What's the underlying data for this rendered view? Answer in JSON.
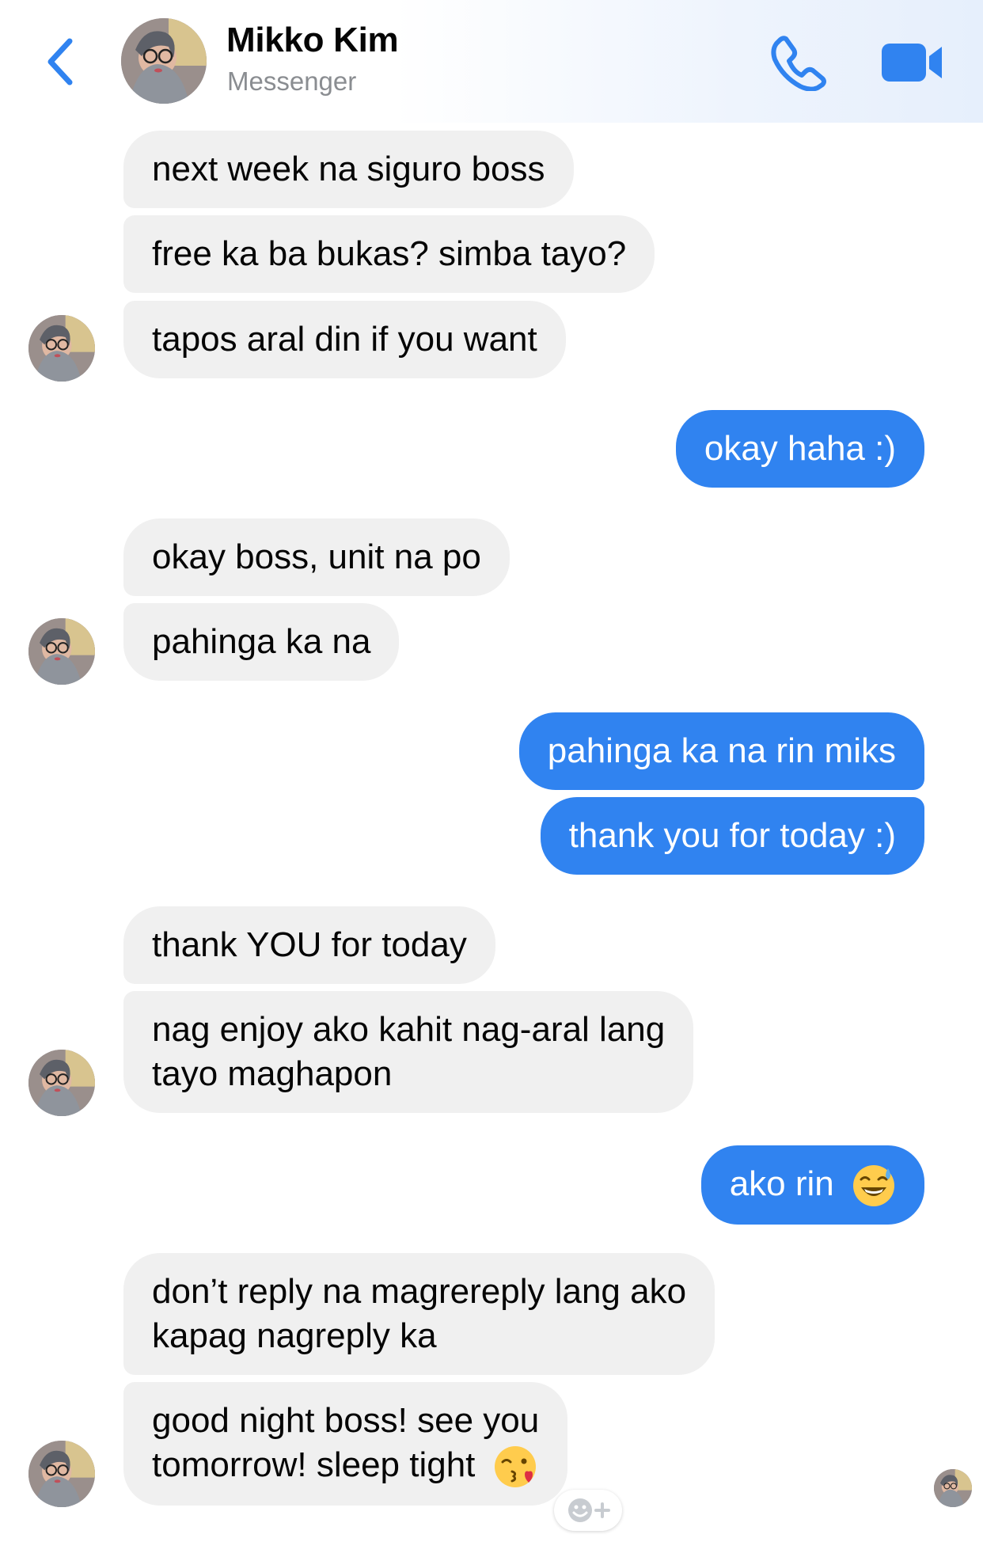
{
  "header": {
    "contact_name": "Mikko Kim",
    "subtitle": "Messenger",
    "accent_color": "#3083f0",
    "icons": [
      "back-chevron-icon",
      "phone-icon",
      "video-camera-icon"
    ]
  },
  "messages": [
    {
      "sender": "contact",
      "text": "next week na siguro boss"
    },
    {
      "sender": "contact",
      "text": "free ka ba bukas? simba tayo?"
    },
    {
      "sender": "contact",
      "text": "tapos aral din if you want"
    },
    {
      "sender": "me",
      "text": "okay haha :)"
    },
    {
      "sender": "contact",
      "text": "okay boss, unit na po"
    },
    {
      "sender": "contact",
      "text": "pahinga ka na"
    },
    {
      "sender": "me",
      "text": "pahinga ka na rin miks"
    },
    {
      "sender": "me",
      "text": "thank you for today :)"
    },
    {
      "sender": "contact",
      "text": "thank YOU for today"
    },
    {
      "sender": "contact",
      "line1": "nag enjoy ako kahit nag-aral lang",
      "line2": "tayo maghapon"
    },
    {
      "sender": "me",
      "text": "ako rin",
      "emoji": "grinning-sweat-emoji"
    },
    {
      "sender": "contact",
      "line1": "don’t reply na magrereply lang ako",
      "line2": "kapag nagreply ka"
    },
    {
      "sender": "contact",
      "line1": "good night boss! see you",
      "line2": "tomorrow! sleep tight",
      "emoji": "kissing-heart-emoji"
    }
  ],
  "colors": {
    "incoming_bubble": "#f0f0f0",
    "outgoing_bubble": "#3083f0"
  }
}
